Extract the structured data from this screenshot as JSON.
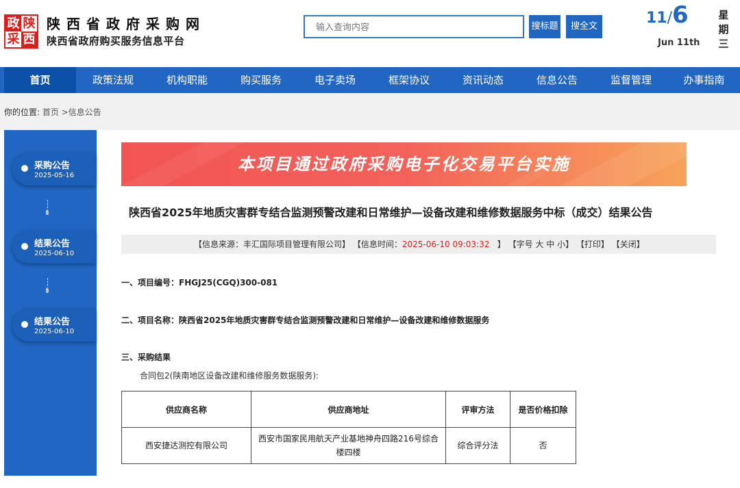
{
  "header": {
    "logo_chars": [
      "政",
      "陕",
      "采",
      "西"
    ],
    "site_title": "陕西省政府采购网",
    "site_subtitle": "陕西省政府购买服务信息平台",
    "search": {
      "placeholder": "输入查询内容",
      "title_button": "搜标题",
      "fulltext_button": "搜全文"
    },
    "date": {
      "month": "11",
      "slash": "/",
      "day": "6",
      "english": "Jun 11th",
      "weekday_chars": [
        "星",
        "期",
        "三"
      ]
    }
  },
  "nav": {
    "items": [
      "首页",
      "政策法规",
      "机构职能",
      "购买服务",
      "电子卖场",
      "框架协议",
      "资讯动态",
      "信息公告",
      "监督管理",
      "办事指南"
    ],
    "active_index": 0
  },
  "breadcrumb": {
    "prefix": "你的位置:",
    "home": "首页",
    "separator": ">",
    "current": "信息公告"
  },
  "sidebar": {
    "items": [
      {
        "title": "采购公告",
        "date": "2025-05-16"
      },
      {
        "title": "结果公告",
        "date": "2025-06-10"
      },
      {
        "title": "结果公告",
        "date": "2025-06-10"
      }
    ]
  },
  "banner": {
    "text": "本项目通过政府采购电子化交易平台实施"
  },
  "notice": {
    "title": "陕西省2025年地质灾害群专结合监测预警改建和日常维护—设备改建和维修数据服务中标（成交）结果公告",
    "meta": {
      "source_prefix": "【信息来源：",
      "source": "丰汇国际项目管理有限公司",
      "source_suffix": "】",
      "time_prefix": "【信息时间：",
      "time": "2025-06-10 09:03:32",
      "time_suffix": "】",
      "font_size": "【字号 大 中 小】",
      "print": "【打印】",
      "close": "【关闭】"
    },
    "sections": {
      "project_no": "一、项目编号：FHGJ25(CGQ)300-081",
      "project_name": "二、项目名称：陕西省2025年地质灾害群专结合监测预警改建和日常维护—设备改建和维修数据服务",
      "result_heading": "三、采购结果",
      "package_line": "合同包2(陕南地区设备改建和维修服务数据服务):"
    },
    "table": {
      "headers": [
        "供应商名称",
        "供应商地址",
        "评审方法",
        "是否价格扣除"
      ],
      "rows": [
        [
          "西安捷达测控有限公司",
          "西安市国家民用航天产业基地神舟四路216号综合楼四楼",
          "综合评分法",
          "否"
        ]
      ]
    }
  },
  "colors": {
    "brand_blue": "#2166c2",
    "nav_active": "#0a4fa8",
    "logo_red": "#d8211d",
    "banner_start": "#f25452",
    "banner_end": "#f7a35a",
    "time_red": "#d8211d"
  }
}
